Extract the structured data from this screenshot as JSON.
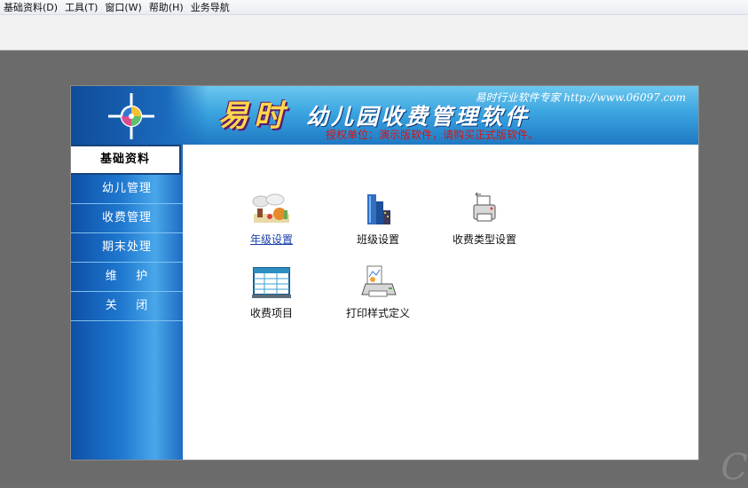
{
  "menubar": {
    "items": [
      "基础资料(D)",
      "工具(T)",
      "窗口(W)",
      "帮助(H)",
      "业务导航"
    ]
  },
  "banner": {
    "brand": "易时",
    "title": "幼儿园收费管理软件",
    "vendor": "易时行业软件专家 http://www.06097.com",
    "license": "授权单位：演示版软件，请购买正式版软件。"
  },
  "sidebar": {
    "items": [
      {
        "label": "基础资料",
        "active": true
      },
      {
        "label": "幼儿管理"
      },
      {
        "label": "收费管理"
      },
      {
        "label": "期末处理"
      },
      {
        "label": "维    护"
      },
      {
        "label": "关    闭"
      }
    ]
  },
  "modules": [
    {
      "label": "年级设置",
      "icon": "grade-settings-icon"
    },
    {
      "label": "班级设置",
      "icon": "class-settings-icon"
    },
    {
      "label": "收费类型设置",
      "icon": "fee-type-settings-icon"
    },
    {
      "label": "收费项目",
      "icon": "fee-items-icon"
    },
    {
      "label": "打印样式定义",
      "icon": "print-style-icon"
    }
  ],
  "colors": {
    "banner_blue": "#3ba5e0",
    "brand_yellow": "#ffd84a",
    "license_red": "#d61414",
    "link_blue": "#1a3fa8"
  }
}
